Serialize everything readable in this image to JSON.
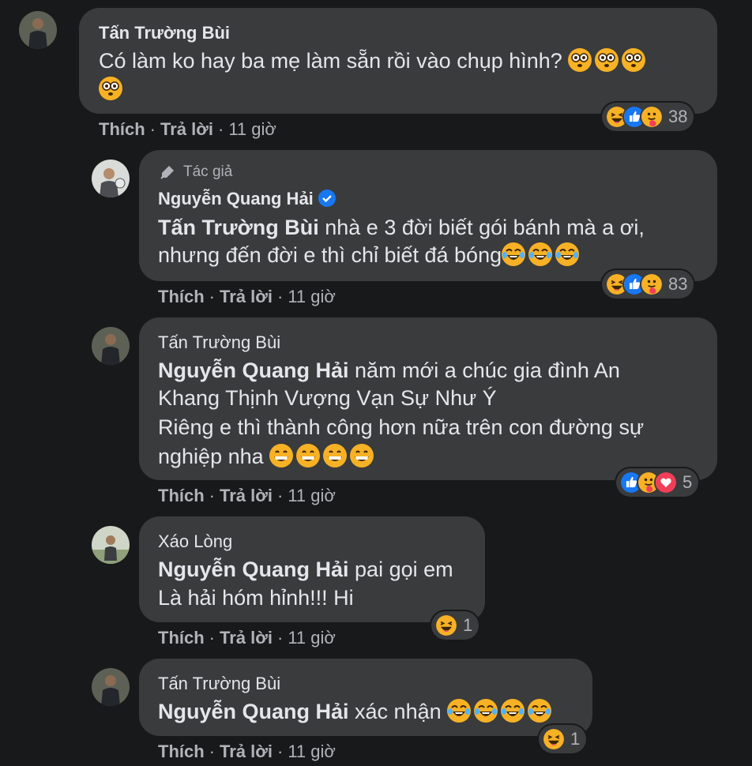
{
  "comments": [
    {
      "author": "Tấn Trường Bùi",
      "text_line1": "Có làm ko hay ba mẹ làm sẵn rồi vào chụp hình?",
      "reactions": [
        "haha",
        "like",
        "care"
      ],
      "reaction_count": "38",
      "actions": {
        "like": "Thích",
        "reply": "Trả lời",
        "time": "11 giờ"
      }
    },
    {
      "badge": "Tác giả",
      "author": "Nguyễn Quang Hải",
      "verified": true,
      "mention": "Tấn Trường Bùi",
      "text_line1_rest": " nhà e 3 đời biết gói bánh mà a ơi,",
      "text_line2": "nhưng đến đời e thì chỉ biết đá bóng",
      "reactions": [
        "haha",
        "like",
        "care"
      ],
      "reaction_count": "83",
      "actions": {
        "like": "Thích",
        "reply": "Trả lời",
        "time": "11 giờ"
      }
    },
    {
      "author": "Tấn Trường Bùi",
      "mention": "Nguyễn Quang Hải",
      "text_line1_rest": " năm mới a chúc gia đình An",
      "text_line2": "Khang Thịnh Vượng Vạn Sự Như Ý",
      "text_line3": "Riêng e thì thành công hơn nữa trên con đường sự",
      "text_line4": "nghiệp nha ",
      "reactions": [
        "like",
        "care",
        "love"
      ],
      "reaction_count": "5",
      "actions": {
        "like": "Thích",
        "reply": "Trả lời",
        "time": "11 giờ"
      }
    },
    {
      "author": "Xáo Lòng",
      "mention": "Nguyễn Quang Hải",
      "text_line1_rest": " pai gọi em",
      "text_line2": "Là hải hóm hỉnh!!! Hi",
      "reactions": [
        "haha"
      ],
      "reaction_count": "1",
      "actions": {
        "like": "Thích",
        "reply": "Trả lời",
        "time": "11 giờ"
      }
    },
    {
      "author": "Tấn Trường Bùi",
      "mention": "Nguyễn Quang Hải",
      "text_line1_rest": " xác nhận ",
      "reactions": [
        "haha"
      ],
      "reaction_count": "1",
      "actions": {
        "like": "Thích",
        "reply": "Trả lời",
        "time": "11 giờ"
      }
    }
  ],
  "colors": {
    "background": "#18191a",
    "bubble": "#3a3b3c",
    "text": "#e4e6eb",
    "secondary": "#b0b3b8",
    "like_blue": "#1877f2",
    "love_red": "#f33e58",
    "emoji_yellow": "#f7b125"
  }
}
